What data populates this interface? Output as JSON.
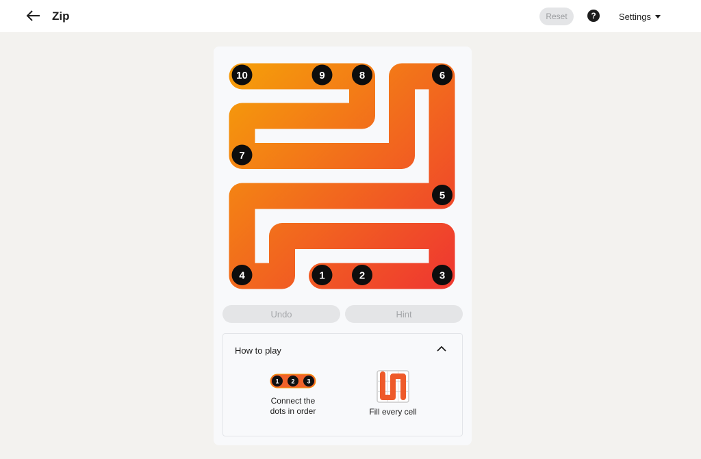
{
  "header": {
    "title": "Zip",
    "reset_label": "Reset",
    "help_label": "?",
    "settings_label": "Settings"
  },
  "board": {
    "grid_size": 6,
    "gradient_start": "#ef3b2f",
    "gradient_end": "#f59a0b",
    "dots": [
      {
        "label": "1",
        "row": 5,
        "col": 2
      },
      {
        "label": "2",
        "row": 5,
        "col": 3
      },
      {
        "label": "3",
        "row": 5,
        "col": 5
      },
      {
        "label": "4",
        "row": 5,
        "col": 0
      },
      {
        "label": "5",
        "row": 3,
        "col": 5
      },
      {
        "label": "6",
        "row": 0,
        "col": 5
      },
      {
        "label": "7",
        "row": 2,
        "col": 0
      },
      {
        "label": "8",
        "row": 0,
        "col": 3
      },
      {
        "label": "9",
        "row": 0,
        "col": 2
      },
      {
        "label": "10",
        "row": 0,
        "col": 0
      }
    ]
  },
  "controls": {
    "undo_label": "Undo",
    "hint_label": "Hint"
  },
  "how_to_play": {
    "title": "How to play",
    "step1_line1": "Connect the",
    "step1_line2": "dots in order",
    "step1_dots": [
      "1",
      "2",
      "3"
    ],
    "step2_text": "Fill every cell"
  }
}
